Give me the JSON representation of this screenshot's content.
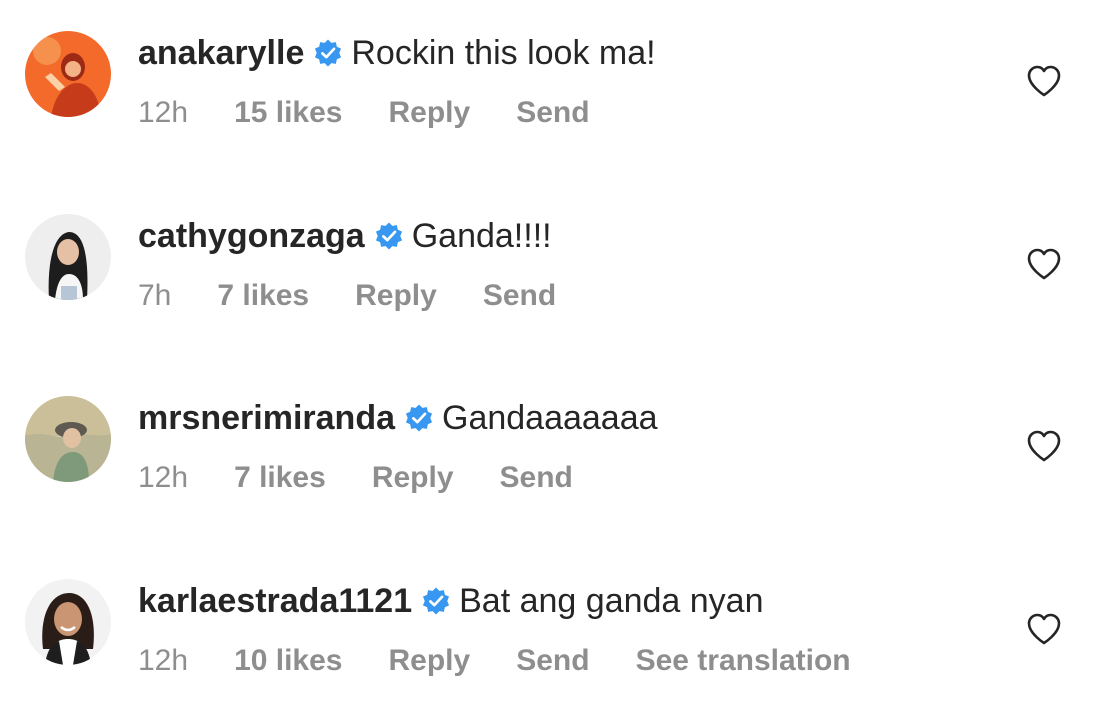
{
  "colors": {
    "username": "#262626",
    "comment_text": "#262626",
    "meta_text": "#8e8e8e",
    "verified_badge": "#3897f0",
    "background": "#ffffff"
  },
  "comments": [
    {
      "username": "anakarylle",
      "verified": true,
      "text": "Rockin this look ma!",
      "time": "12h",
      "likes": "15 likes",
      "reply_label": "Reply",
      "send_label": "Send",
      "avatar": "avatar-orange-portrait",
      "like_icon": "heart-outline-icon"
    },
    {
      "username": "cathygonzaga",
      "verified": true,
      "text": "Ganda!!!!",
      "time": "7h",
      "likes": "7 likes",
      "reply_label": "Reply",
      "send_label": "Send",
      "avatar": "avatar-woman-long-hair",
      "like_icon": "heart-outline-icon"
    },
    {
      "username": "mrsnerimiranda",
      "verified": true,
      "text": "Gandaaaaaaa",
      "time": "12h",
      "likes": "7 likes",
      "reply_label": "Reply",
      "send_label": "Send",
      "avatar": "avatar-woman-hat-outdoor",
      "like_icon": "heart-outline-icon"
    },
    {
      "username": "karlaestrada1121",
      "verified": true,
      "text": "Bat ang ganda nyan",
      "time": "12h",
      "likes": "10 likes",
      "reply_label": "Reply",
      "send_label": "Send",
      "translation_label": "See translation",
      "avatar": "avatar-woman-smiling",
      "like_icon": "heart-outline-icon"
    }
  ]
}
